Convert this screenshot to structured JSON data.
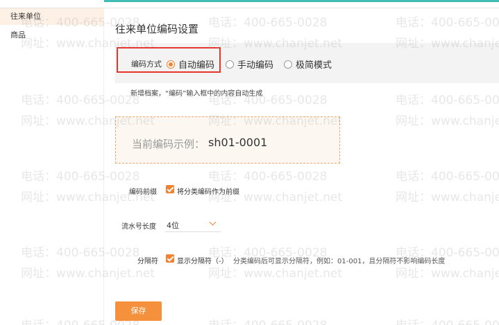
{
  "sidebar": {
    "items": [
      {
        "label": "往来单位"
      },
      {
        "label": "商品"
      }
    ]
  },
  "page": {
    "title": "往来单位编码设置"
  },
  "coding_mode": {
    "label": "编码方式",
    "options": [
      {
        "label": "自动编码",
        "checked": true
      },
      {
        "label": "手动编码",
        "checked": false
      },
      {
        "label": "极简模式",
        "checked": false
      }
    ],
    "hint": "新增档案，“编码”输入框中的内容自动生成"
  },
  "example": {
    "label": "当前编码示例：",
    "value": "sh01-0001"
  },
  "prefix": {
    "label": "编码前缀",
    "checkbox_label": "将分类编码作为前缀",
    "checked": true
  },
  "serial_length": {
    "label": "流水号长度",
    "value": "4位"
  },
  "separator": {
    "label": "分隔符",
    "checkbox_label": "显示分隔符（-）",
    "checked": true,
    "description": "分类编码后可显示分隔符，例如：01-001，且分隔符不影响编码长度"
  },
  "actions": {
    "save_label": "保存"
  },
  "watermark": {
    "phone": "电话：400-665-0028",
    "site": "网址：www.chanjet.net"
  },
  "colors": {
    "accent": "#f08232",
    "button": "#f5913c",
    "highlight": "#e4342c",
    "top_accent": "#3fbcb3"
  }
}
